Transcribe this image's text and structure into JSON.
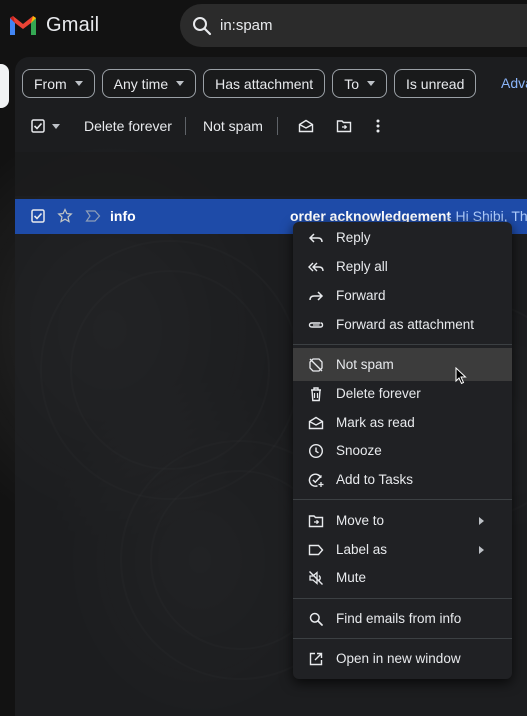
{
  "app": {
    "brand": "Gmail"
  },
  "search": {
    "query": "in:spam"
  },
  "filters": {
    "chips": [
      "From",
      "Any time",
      "Has attachment",
      "To",
      "Is unread"
    ],
    "advanced_link": "Adva"
  },
  "toolbar": {
    "delete_forever": "Delete forever",
    "not_spam": "Not spam"
  },
  "email_row": {
    "sender": "info",
    "subject": "order acknowledgement",
    "snippet": "- Hi Shibi, Than"
  },
  "context_menu": {
    "reply": "Reply",
    "reply_all": "Reply all",
    "forward": "Forward",
    "forward_as_attachment": "Forward as attachment",
    "not_spam": "Not spam",
    "delete_forever": "Delete forever",
    "mark_as_read": "Mark as read",
    "snooze": "Snooze",
    "add_to_tasks": "Add to Tasks",
    "move_to": "Move to",
    "label_as": "Label as",
    "mute": "Mute",
    "find_emails_from": "Find emails from info",
    "open_in_new_window": "Open in new window"
  },
  "colors": {
    "selected_row": "#1e4ba8",
    "menu_bg": "#202124",
    "menu_hover": "#3c3c3c",
    "link": "#8ab4f8"
  }
}
